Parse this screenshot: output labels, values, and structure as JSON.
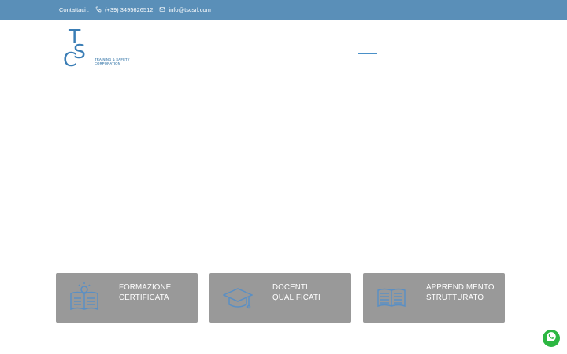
{
  "topbar": {
    "contact_label": "Contattaci :",
    "phone": "(+39) 3495626512",
    "email": "info@tscsrl.com"
  },
  "logo": {
    "letters": [
      "T",
      "S",
      "C"
    ],
    "tagline_line1": "TRAINING & SAFETY",
    "tagline_line2": "CORPORATION"
  },
  "features": [
    {
      "line1": "FORMAZIONE",
      "line2": "CERTIFICATA",
      "icon": "certificate-book-icon"
    },
    {
      "line1": "DOCENTI",
      "line2": "QUALIFICATI",
      "icon": "graduation-cap-icon"
    },
    {
      "line1": "APPRENDIMENTO",
      "line2": "STRUTTURATO",
      "icon": "open-book-icon"
    }
  ],
  "colors": {
    "topbar_bg": "#5a8fb8",
    "card_bg": "#999999",
    "accent": "#4a90c8",
    "whatsapp": "#2cb742"
  }
}
